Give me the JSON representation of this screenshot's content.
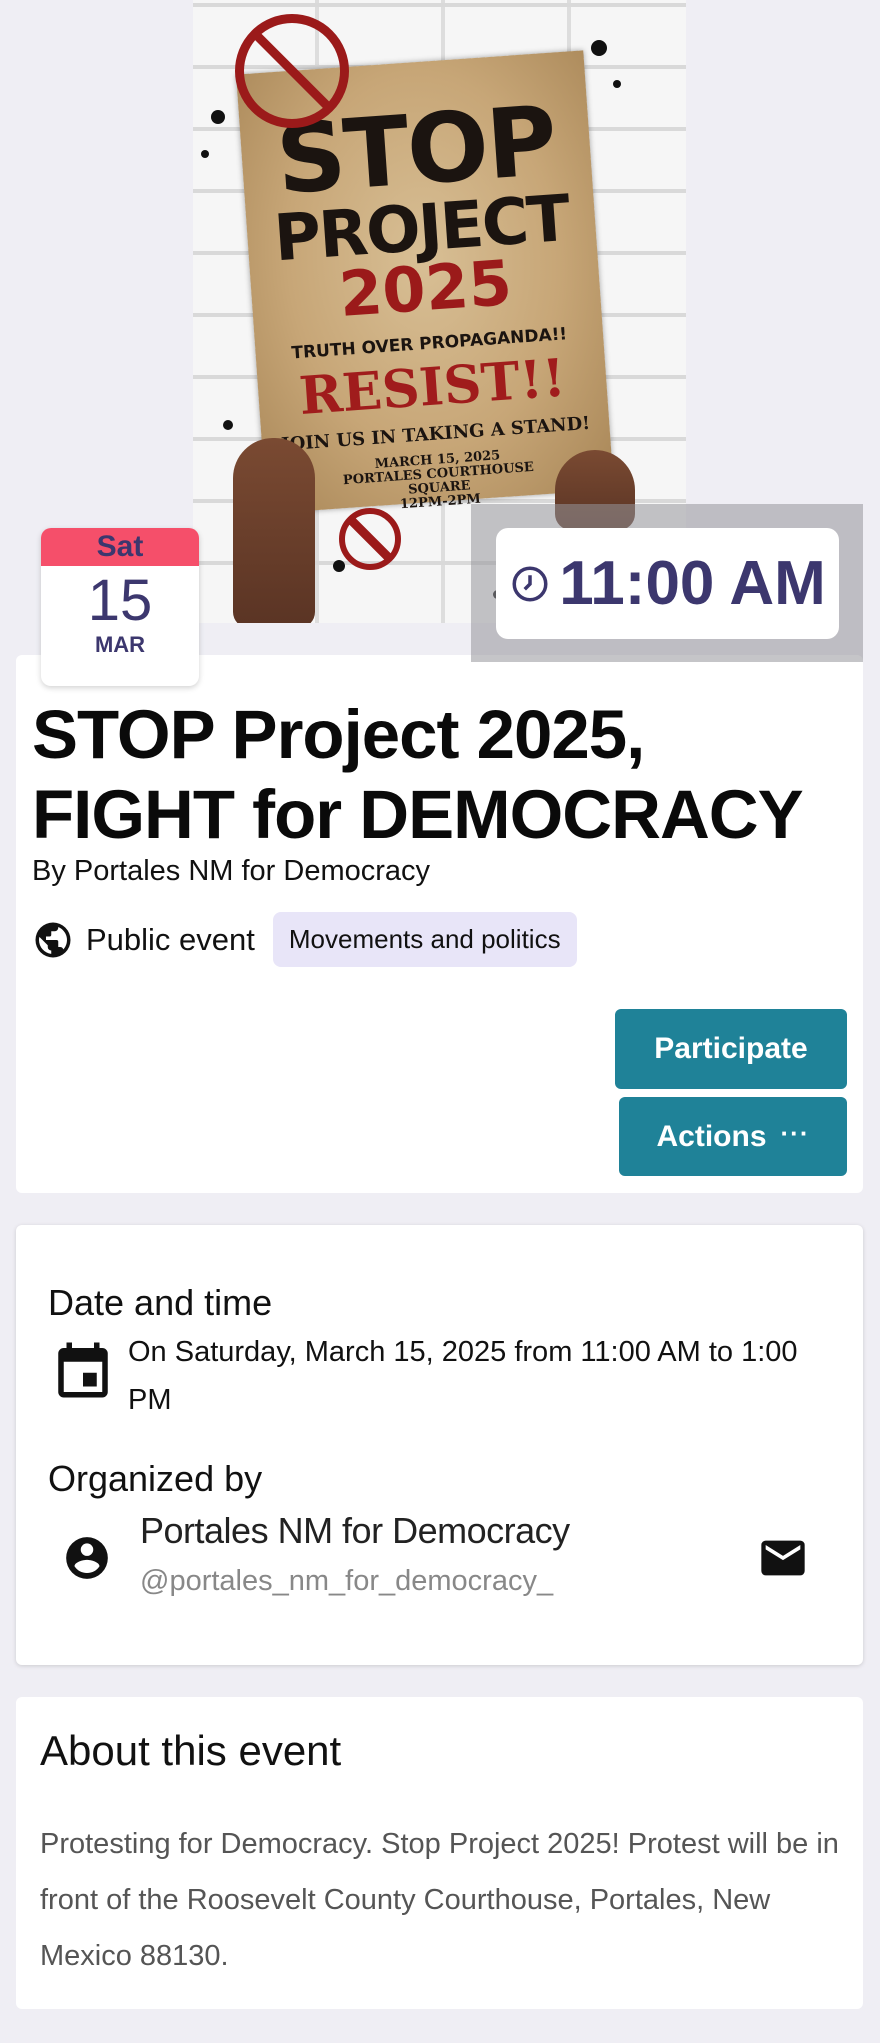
{
  "banner": {
    "poster": {
      "line1": "STOP",
      "line2": "PROJECT",
      "line3": "2025",
      "line4": "TRUTH OVER PROPAGANDA!!",
      "line5": "RESIST!!",
      "line6": "JOIN US IN TAKING A STAND!",
      "line7": "MARCH 15, 2025",
      "line8": "PORTALES COURTHOUSE",
      "line9": "SQUARE",
      "line10": "12PM-2PM"
    }
  },
  "date_card": {
    "weekday": "Sat",
    "day": "15",
    "month": "MAR"
  },
  "time_badge": {
    "time": "11:00 AM"
  },
  "event": {
    "title": "STOP Project 2025, FIGHT for DEMOCRACY",
    "organizer_line": "By Portales NM for Democracy",
    "visibility": "Public event",
    "category_tag": "Movements and politics",
    "participate_label": "Participate",
    "actions_label": "Actions",
    "actions_dots": "···"
  },
  "details": {
    "date_heading": "Date and time",
    "date_text": "On Saturday, March 15, 2025 from 11:00 AM to 1:00 PM",
    "organized_heading": "Organized by",
    "organizer_name": "Portales NM for Democracy",
    "organizer_handle": "@portales_nm_for_democracy_"
  },
  "about": {
    "heading": "About this event",
    "text": "Protesting for Democracy. Stop Project 2025! Protest will be in front of the Roosevelt County Courthouse, Portales, New Mexico 88130."
  },
  "colors": {
    "accent": "#1f8298",
    "date_header": "#f54f6a",
    "primary_text": "#3c376e",
    "tag_bg": "#e8e5f8"
  },
  "icons": {
    "globe": "globe-icon",
    "clock": "clock-icon",
    "calendar": "calendar-icon",
    "account": "account-circle-icon",
    "mail": "mail-icon"
  }
}
